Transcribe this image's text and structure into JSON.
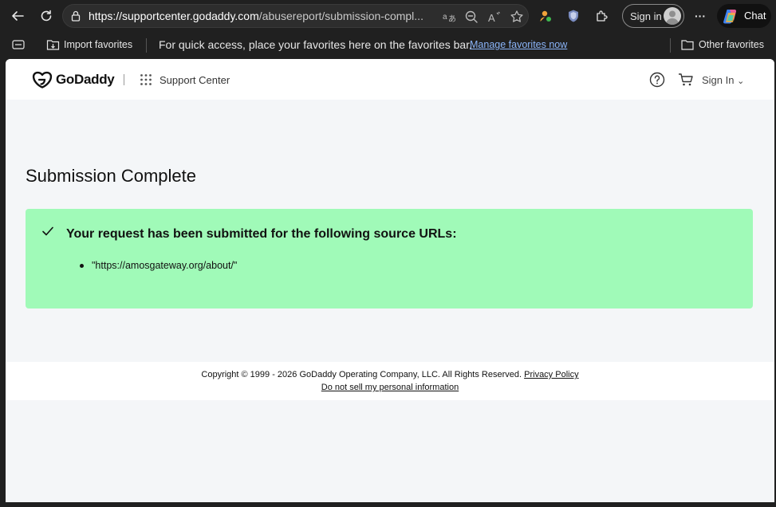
{
  "browser": {
    "url_main": "https://supportcenter.godaddy.com",
    "url_rest": "/abusereport/submission-compl...",
    "sign_in_label": "Sign in",
    "chat_label": "Chat",
    "more_label": "···"
  },
  "favorites_bar": {
    "import_label": "Import favorites",
    "hint_text": "For quick access, place your favorites here on the favorites bar.",
    "manage_link": "Manage favorites now",
    "other_favorites": "Other favorites"
  },
  "site_header": {
    "logo_text": "GoDaddy",
    "section_label": "Support Center",
    "sign_in_label": "Sign In",
    "sign_in_chevron": "⌄"
  },
  "main": {
    "title": "Submission Complete",
    "message": "Your request has been submitted for the following source URLs:",
    "urls": [
      "\"https://amosgateway.org/about/\""
    ]
  },
  "footer": {
    "copyright": "Copyright © 1999 - 2026 GoDaddy Operating Company, LLC. All Rights Reserved.",
    "privacy_link": "Privacy Policy",
    "do_not_sell_link": "Do not sell my personal information"
  },
  "colors": {
    "success_panel": "#a0fab8",
    "page_bg": "#f4f6f8",
    "chrome_bg": "#202020",
    "link_blue": "#8ab4f8"
  }
}
